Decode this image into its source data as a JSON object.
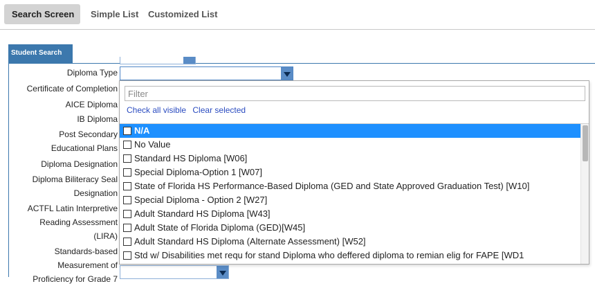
{
  "tabs": {
    "search_screen": "Search Screen",
    "simple_list": "Simple List",
    "customized_list": "Customized List"
  },
  "panel": {
    "title": "Student Search"
  },
  "labels": {
    "diploma_type": "Diploma Type",
    "certificate_of_completion": "Certificate of Completion",
    "aice_diploma": "AICE Diploma",
    "ib_diploma": "IB Diploma",
    "post_secondary": "Post Secondary",
    "educational_plans": "Educational Plans",
    "diploma_designation": "Diploma Designation",
    "diploma_biliteracy_seal_1": "Diploma Biliteracy Seal",
    "diploma_biliteracy_seal_2": "Designation",
    "actfl_1": "ACTFL Latin Interpretive",
    "actfl_2": "Reading Assessment",
    "actfl_3": "(LIRA)",
    "standards_1": "Standards-based",
    "standards_2": "Measurement of",
    "standards_3": "Proficiency for Grade 7"
  },
  "dropdown": {
    "filter_placeholder": "Filter",
    "filter_value": "",
    "check_all": "Check all visible",
    "clear_selected": "Clear selected",
    "options": [
      "N/A",
      "No Value",
      "Standard HS Diploma [W06]",
      "Special Diploma-Option 1 [W07]",
      "State of Florida HS Performance-Based Diploma (GED and State Approved Graduation Test) [W10]",
      "Special Diploma - Option 2 [W27]",
      "Adult Standard HS Diploma [W43]",
      "Adult State of Florida Diploma (GED)[W45]",
      "Adult Standard HS Diploma (Alternate Assessment) [W52]",
      "Std w/ Disabilities met requ for stand Diploma who deffered diploma to remian elig for FAPE [WD1"
    ],
    "highlighted_index": 0
  },
  "colors": {
    "panel_blue": "#3c78ad",
    "highlight": "#1e90ff",
    "link": "#2b4cc0",
    "select_arrow": "#5a8cc6"
  },
  "icons": {
    "dropdown_arrow": "chevron-down-icon",
    "checkbox": "checkbox-icon"
  }
}
